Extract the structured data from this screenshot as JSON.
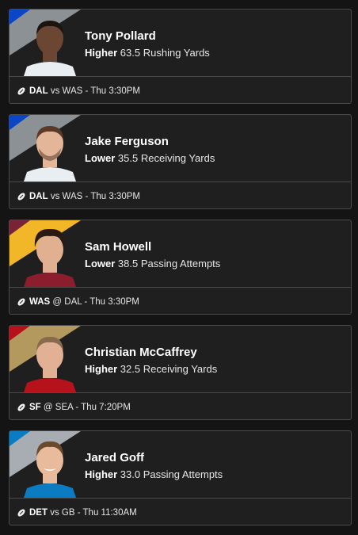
{
  "picks": [
    {
      "name": "Tony Pollard",
      "direction": "Higher",
      "line": "63.5",
      "stat": "Rushing Yards",
      "team": "DAL",
      "matchup_rest": "vs WAS - Thu 3:30PM",
      "colors": {
        "primary": "#0b46c7",
        "secondary": "#8c9196",
        "skin": "#6b4632",
        "hair": "#1c140f",
        "shirt": "#e9eef3"
      }
    },
    {
      "name": "Jake Ferguson",
      "direction": "Lower",
      "line": "35.5",
      "stat": "Receiving Yards",
      "team": "DAL",
      "matchup_rest": "vs WAS - Thu 3:30PM",
      "colors": {
        "primary": "#0b46c7",
        "secondary": "#8c9196",
        "skin": "#e3b69a",
        "hair": "#5a3a26",
        "shirt": "#e9eef3"
      }
    },
    {
      "name": "Sam Howell",
      "direction": "Lower",
      "line": "38.5",
      "stat": "Passing Attempts",
      "team": "WAS",
      "matchup_rest": "@ DAL - Thu 3:30PM",
      "colors": {
        "primary": "#7a2236",
        "secondary": "#f2b629",
        "skin": "#e0b090",
        "hair": "#2a1a12",
        "shirt": "#8c1d2c"
      }
    },
    {
      "name": "Christian McCaffrey",
      "direction": "Higher",
      "line": "32.5",
      "stat": "Receiving Yards",
      "team": "SF",
      "matchup_rest": "@ SEA - Thu 7:20PM",
      "colors": {
        "primary": "#b5121b",
        "secondary": "#b3995d",
        "skin": "#e2b095",
        "hair": "#8a6a4e",
        "shirt": "#b5121b"
      }
    },
    {
      "name": "Jared Goff",
      "direction": "Higher",
      "line": "33.0",
      "stat": "Passing Attempts",
      "team": "DET",
      "matchup_rest": "vs GB - Thu 11:30AM",
      "colors": {
        "primary": "#0b7cc1",
        "secondary": "#a7adb3",
        "skin": "#e9bb9d",
        "hair": "#6b4a2c",
        "shirt": "#0b7cc1"
      }
    }
  ]
}
